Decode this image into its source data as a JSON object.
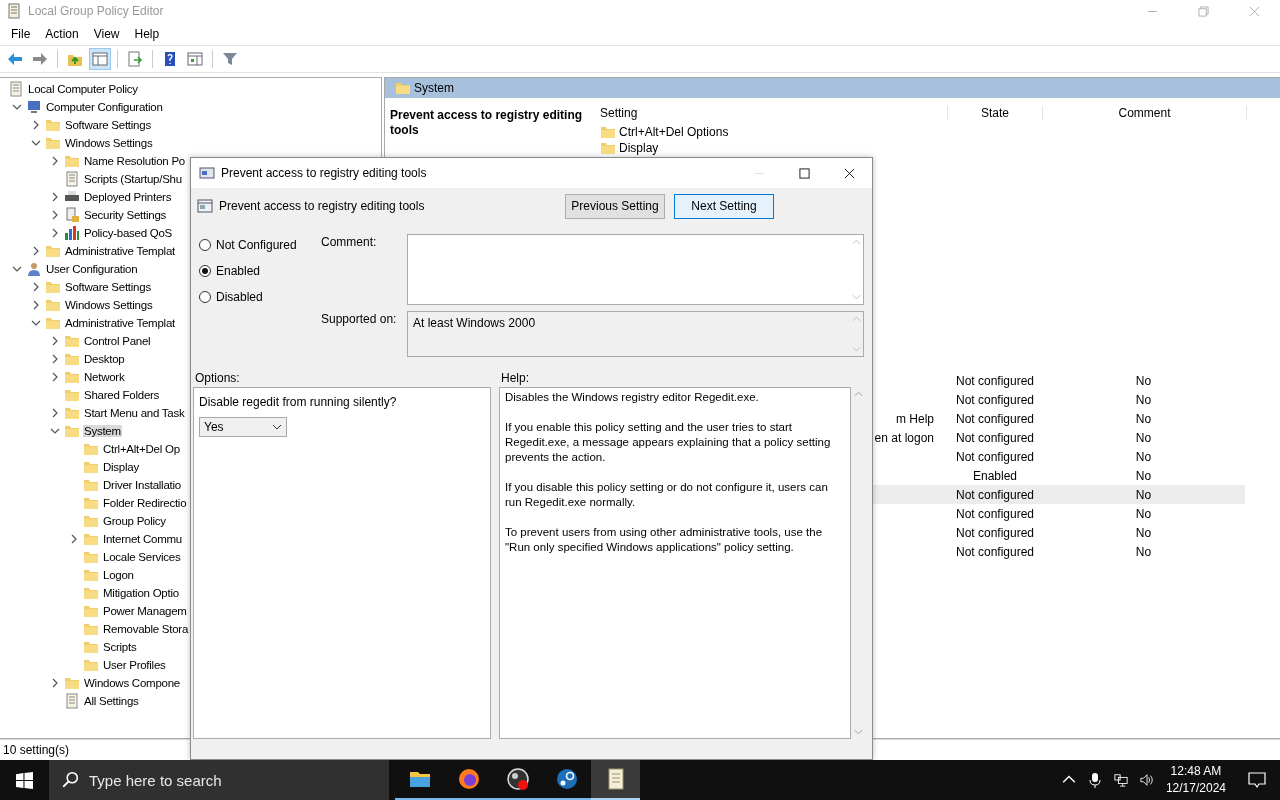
{
  "window": {
    "title": "Local Group Policy Editor"
  },
  "menu": [
    "File",
    "Action",
    "View",
    "Help"
  ],
  "toolbar": [
    {
      "kind": "back",
      "pressed": false
    },
    {
      "kind": "forward",
      "pressed": false
    },
    {
      "kind": "up",
      "pressed": false
    },
    {
      "kind": "tree",
      "pressed": true
    },
    {
      "kind": "export",
      "pressed": false
    },
    {
      "kind": "help",
      "pressed": false
    },
    {
      "kind": "view",
      "pressed": false
    },
    {
      "kind": "filter",
      "pressed": false
    }
  ],
  "tree": [
    {
      "label": "Local Computer Policy",
      "kind": "policy",
      "selected": false,
      "children": [
        {
          "label": "Computer Configuration",
          "kind": "computer",
          "expanded": true,
          "selected": false,
          "children": [
            {
              "label": "Software Settings",
              "kind": "folder",
              "expanded": false,
              "selected": false
            },
            {
              "label": "Windows Settings",
              "kind": "folder",
              "expanded": true,
              "selected": false,
              "children": [
                {
                  "label": "Name Resolution Po",
                  "kind": "folder",
                  "expanded": false,
                  "selected": false
                },
                {
                  "label": "Scripts (Startup/Shu",
                  "kind": "script",
                  "selected": false
                },
                {
                  "label": "Deployed Printers",
                  "kind": "printer",
                  "expanded": false,
                  "selected": false
                },
                {
                  "label": "Security Settings",
                  "kind": "security",
                  "expanded": false,
                  "selected": false
                },
                {
                  "label": "Policy-based QoS",
                  "kind": "chart",
                  "expanded": false,
                  "selected": false
                }
              ]
            },
            {
              "label": "Administrative Templat",
              "kind": "folder",
              "expanded": false,
              "selected": false
            }
          ]
        },
        {
          "label": "User Configuration",
          "kind": "user",
          "expanded": true,
          "selected": false,
          "children": [
            {
              "label": "Software Settings",
              "kind": "folder",
              "expanded": false,
              "selected": false
            },
            {
              "label": "Windows Settings",
              "kind": "folder",
              "expanded": false,
              "selected": false
            },
            {
              "label": "Administrative Templat",
              "kind": "folder",
              "expanded": true,
              "selected": false,
              "children": [
                {
                  "label": "Control Panel",
                  "kind": "folder",
                  "expanded": false,
                  "selected": false
                },
                {
                  "label": "Desktop",
                  "kind": "folder",
                  "expanded": false,
                  "selected": false
                },
                {
                  "label": "Network",
                  "kind": "folder",
                  "expanded": false,
                  "selected": false
                },
                {
                  "label": "Shared Folders",
                  "kind": "folder",
                  "selected": false
                },
                {
                  "label": "Start Menu and Task",
                  "kind": "folder",
                  "expanded": false,
                  "selected": false
                },
                {
                  "label": "System",
                  "kind": "folder",
                  "expanded": true,
                  "selected": true,
                  "children": [
                    {
                      "label": "Ctrl+Alt+Del Op",
                      "kind": "folder",
                      "selected": false
                    },
                    {
                      "label": "Display",
                      "kind": "folder",
                      "selected": false
                    },
                    {
                      "label": "Driver Installatio",
                      "kind": "folder",
                      "selected": false
                    },
                    {
                      "label": "Folder Redirectio",
                      "kind": "folder",
                      "selected": false
                    },
                    {
                      "label": "Group Policy",
                      "kind": "folder",
                      "selected": false
                    },
                    {
                      "label": "Internet Commu",
                      "kind": "folder",
                      "expanded": false,
                      "selected": false
                    },
                    {
                      "label": "Locale Services",
                      "kind": "folder",
                      "selected": false
                    },
                    {
                      "label": "Logon",
                      "kind": "folder",
                      "selected": false
                    },
                    {
                      "label": "Mitigation Optio",
                      "kind": "folder",
                      "selected": false
                    },
                    {
                      "label": "Power Managem",
                      "kind": "folder",
                      "selected": false
                    },
                    {
                      "label": "Removable Stora",
                      "kind": "folder",
                      "selected": false
                    },
                    {
                      "label": "Scripts",
                      "kind": "folder",
                      "selected": false
                    },
                    {
                      "label": "User Profiles",
                      "kind": "folder",
                      "selected": false
                    }
                  ]
                },
                {
                  "label": "Windows Compone",
                  "kind": "folder",
                  "expanded": false,
                  "selected": false
                },
                {
                  "label": "All Settings",
                  "kind": "settings",
                  "selected": false
                }
              ]
            }
          ]
        }
      ]
    }
  ],
  "details": {
    "header": "System",
    "description": "Prevent access to registry editing tools",
    "columns": [
      "Setting",
      "State",
      "Comment"
    ],
    "folders": [
      "Ctrl+Alt+Del Options",
      "Display"
    ],
    "policies": [
      {
        "state": "Not configured",
        "comment": "No",
        "selected": false
      },
      {
        "state": "Not configured",
        "comment": "No",
        "selected": false
      },
      {
        "setting": "m Help",
        "state": "Not configured",
        "comment": "No",
        "selected": false
      },
      {
        "setting": "en at logon",
        "state": "Not configured",
        "comment": "No",
        "selected": false
      },
      {
        "state": "Not configured",
        "comment": "No",
        "selected": false
      },
      {
        "state": "Enabled",
        "comment": "No",
        "selected": false
      },
      {
        "state": "Not configured",
        "comment": "No",
        "selected": true
      },
      {
        "state": "Not configured",
        "comment": "No",
        "selected": false
      },
      {
        "state": "Not configured",
        "comment": "No",
        "selected": false
      },
      {
        "state": "Not configured",
        "comment": "No",
        "selected": false
      }
    ]
  },
  "status_bar": "10 setting(s)",
  "dialog": {
    "title": "Prevent access to registry editing tools",
    "heading": "Prevent access to registry editing tools",
    "buttons": [
      {
        "label": "Previous Setting",
        "focused": false
      },
      {
        "label": "Next Setting",
        "focused": true
      }
    ],
    "radios": [
      {
        "label": "Not Configured",
        "selected": false
      },
      {
        "label": "Enabled",
        "selected": true
      },
      {
        "label": "Disabled",
        "selected": false
      }
    ],
    "comment_label": "Comment:",
    "supported_label": "Supported on:",
    "supported_value": "At least Windows 2000",
    "options_label": "Options:",
    "help_label": "Help:",
    "option_prompt": "Disable regedit from running silently?",
    "option_value": "Yes",
    "help": [
      "Disables the Windows registry editor Regedit.exe.",
      "If you enable this policy setting and the user tries to start Regedit.exe, a message appears explaining that a policy setting prevents the action.",
      "If you disable this policy setting or do not configure it, users can run Regedit.exe normally.",
      "To prevent users from using other administrative tools, use the \"Run only specified Windows applications\" policy setting."
    ]
  },
  "taskbar": {
    "search_placeholder": "Type here to search",
    "apps": [
      {
        "kind": "explorer",
        "active": false
      },
      {
        "kind": "firefox",
        "active": false
      },
      {
        "kind": "obs",
        "active": false
      },
      {
        "kind": "steam",
        "active": false
      },
      {
        "kind": "notepad",
        "active": true
      }
    ],
    "time": "12:48 AM",
    "date": "12/17/2024"
  }
}
